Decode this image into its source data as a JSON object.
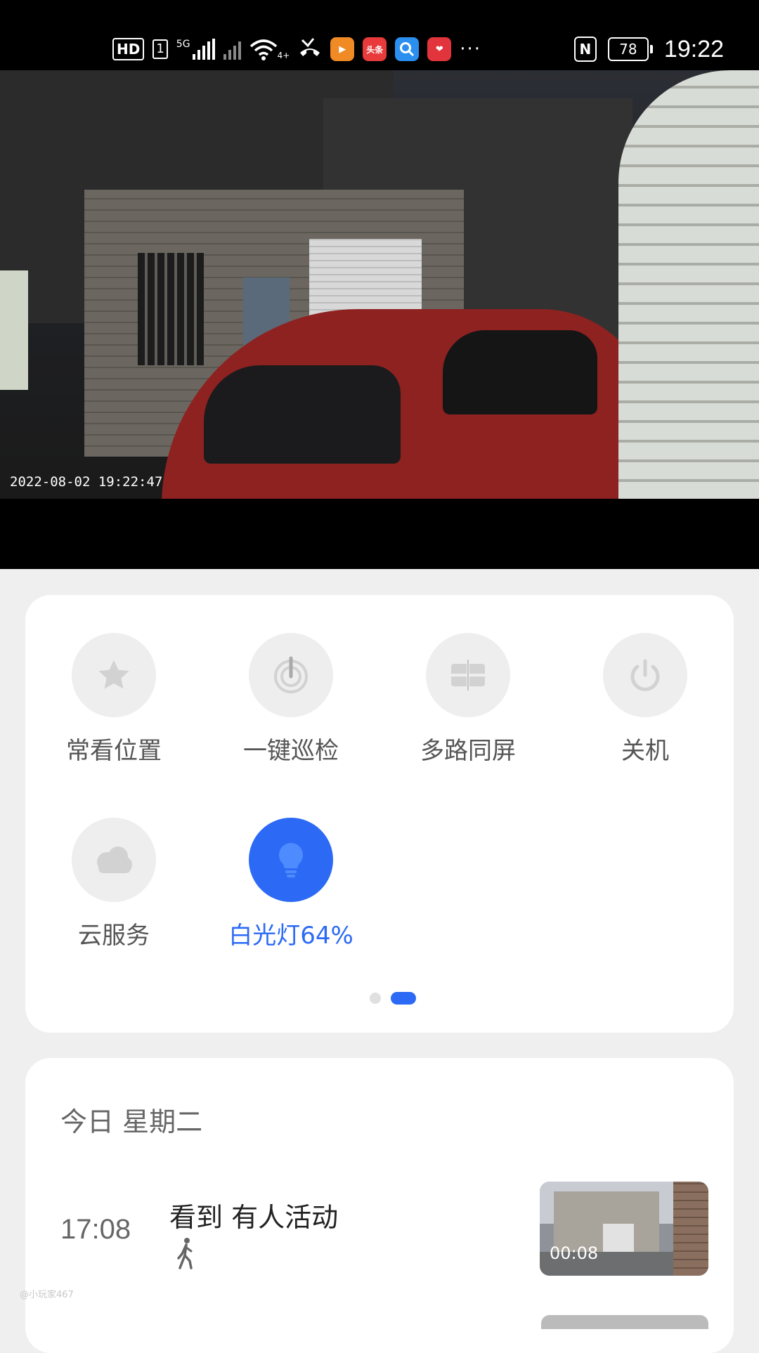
{
  "status_bar": {
    "hd": "HD",
    "sim": "1",
    "network": "5G",
    "wifi_sub": "4+",
    "app_toutiao": "头条",
    "battery": "78",
    "time": "19:22"
  },
  "video": {
    "timestamp": "2022-08-02   19:22:47"
  },
  "controls": {
    "buttons": [
      {
        "label": "常看位置",
        "icon": "star-icon"
      },
      {
        "label": "一键巡检",
        "icon": "patrol-icon"
      },
      {
        "label": "多路同屏",
        "icon": "multi-screen-icon"
      },
      {
        "label": "关机",
        "icon": "power-icon"
      },
      {
        "label": "云服务",
        "icon": "cloud-icon"
      },
      {
        "label": "白光灯64%",
        "icon": "bulb-icon",
        "active": true
      }
    ],
    "pager": {
      "pages": 2,
      "current": 2
    },
    "accent": "#2c6af5"
  },
  "events": {
    "day": "今日 星期二",
    "items": [
      {
        "time": "17:08",
        "title": "看到 有人活动",
        "icon": "walking-person-icon",
        "duration": "00:08"
      }
    ]
  },
  "watermark": "@小玩家467"
}
